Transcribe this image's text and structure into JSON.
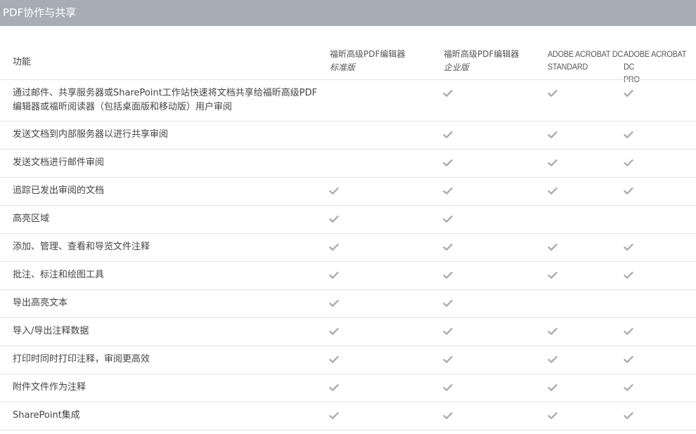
{
  "section": {
    "title": "PDF协作与共享"
  },
  "table": {
    "feature_header": "功能",
    "columns": [
      {
        "line1": "福昕高级PDF编辑器",
        "line2": "标准版"
      },
      {
        "line1": "福昕高级PDF编辑器",
        "line2": "企业版"
      },
      {
        "line1": "ADOBE ACROBAT DC",
        "line2": "STANDARD"
      },
      {
        "line1": "ADOBE ACROBAT DC",
        "line2": "PRO"
      }
    ],
    "rows": [
      {
        "label": "通过邮件、共享服务器或SharePoint工作站快速将文档共享给福昕高级PDF编辑器或福昕阅读器（包括桌面版和移动版）用户审阅",
        "checks": [
          false,
          true,
          true,
          true
        ]
      },
      {
        "label": "发送文档到内部服务器以进行共享审阅",
        "checks": [
          false,
          true,
          true,
          true
        ]
      },
      {
        "label": "发送文档进行邮件审阅",
        "checks": [
          false,
          true,
          true,
          true
        ]
      },
      {
        "label": "追踪已发出审阅的文档",
        "checks": [
          true,
          true,
          true,
          true
        ]
      },
      {
        "label": "高亮区域",
        "checks": [
          true,
          true,
          false,
          false
        ]
      },
      {
        "label": "添加、管理、查看和导览文件注释",
        "checks": [
          true,
          true,
          true,
          true
        ]
      },
      {
        "label": "批注、标注和绘图工具",
        "checks": [
          true,
          true,
          true,
          true
        ]
      },
      {
        "label": "导出高亮文本",
        "checks": [
          true,
          true,
          false,
          false
        ]
      },
      {
        "label": "导入/导出注释数据",
        "checks": [
          true,
          true,
          true,
          true
        ]
      },
      {
        "label": "打印时同时打印注释，审阅更高效",
        "checks": [
          true,
          true,
          true,
          true
        ]
      },
      {
        "label": "附件文件作为注释",
        "checks": [
          true,
          true,
          true,
          true
        ]
      },
      {
        "label": "SharePoint集成",
        "checks": [
          true,
          true,
          true,
          true
        ]
      }
    ]
  },
  "colors": {
    "header_bg": "#a7adb5",
    "check": "#a9adb1",
    "divider": "#e3e3e3"
  },
  "icons": {
    "check": "checkmark-icon"
  }
}
